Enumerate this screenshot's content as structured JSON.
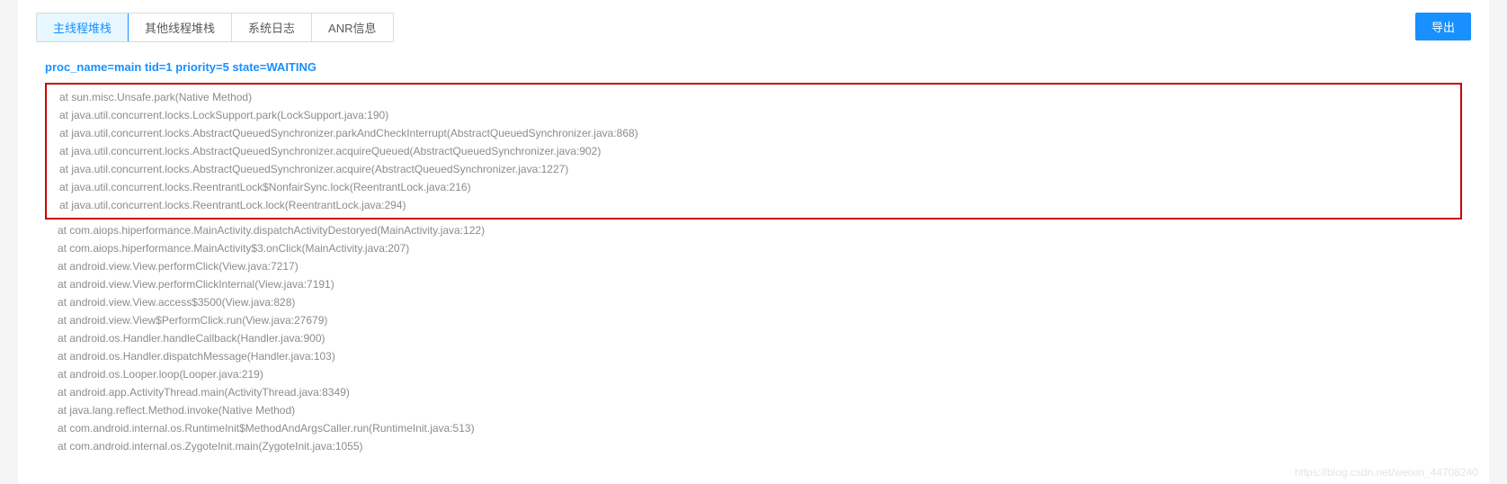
{
  "tabs": {
    "items": [
      {
        "label": "主线程堆栈",
        "active": true
      },
      {
        "label": "其他线程堆栈",
        "active": false
      },
      {
        "label": "系统日志",
        "active": false
      },
      {
        "label": "ANR信息",
        "active": false
      }
    ]
  },
  "buttons": {
    "export": "导出"
  },
  "thread": {
    "header": "proc_name=main tid=1 priority=5 state=WAITING",
    "highlighted_trace": [
      "at sun.misc.Unsafe.park(Native Method)",
      "at java.util.concurrent.locks.LockSupport.park(LockSupport.java:190)",
      "at java.util.concurrent.locks.AbstractQueuedSynchronizer.parkAndCheckInterrupt(AbstractQueuedSynchronizer.java:868)",
      "at java.util.concurrent.locks.AbstractQueuedSynchronizer.acquireQueued(AbstractQueuedSynchronizer.java:902)",
      "at java.util.concurrent.locks.AbstractQueuedSynchronizer.acquire(AbstractQueuedSynchronizer.java:1227)",
      "at java.util.concurrent.locks.ReentrantLock$NonfairSync.lock(ReentrantLock.java:216)",
      "at java.util.concurrent.locks.ReentrantLock.lock(ReentrantLock.java:294)"
    ],
    "rest_trace": [
      "at com.aiops.hiperformance.MainActivity.dispatchActivityDestoryed(MainActivity.java:122)",
      "at com.aiops.hiperformance.MainActivity$3.onClick(MainActivity.java:207)",
      "at android.view.View.performClick(View.java:7217)",
      "at android.view.View.performClickInternal(View.java:7191)",
      "at android.view.View.access$3500(View.java:828)",
      "at android.view.View$PerformClick.run(View.java:27679)",
      "at android.os.Handler.handleCallback(Handler.java:900)",
      "at android.os.Handler.dispatchMessage(Handler.java:103)",
      "at android.os.Looper.loop(Looper.java:219)",
      "at android.app.ActivityThread.main(ActivityThread.java:8349)",
      "at java.lang.reflect.Method.invoke(Native Method)",
      "at com.android.internal.os.RuntimeInit$MethodAndArgsCaller.run(RuntimeInit.java:513)",
      "at com.android.internal.os.ZygoteInit.main(ZygoteInit.java:1055)"
    ]
  },
  "watermark": "https://blog.csdn.net/weixin_44708240"
}
